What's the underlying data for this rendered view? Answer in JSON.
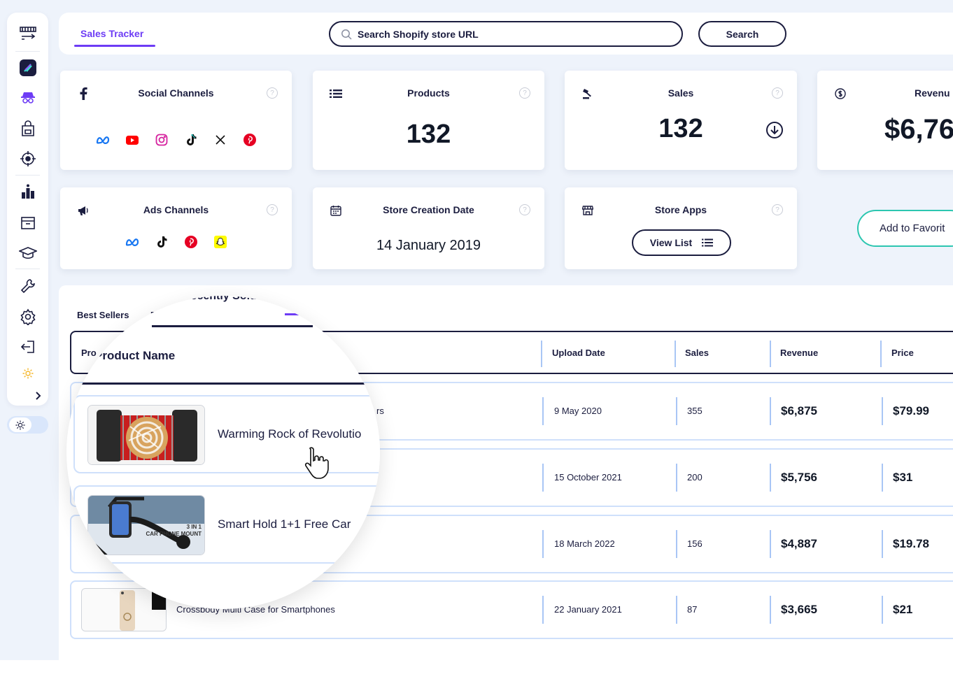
{
  "topbar": {
    "tab_label": "Sales Tracker",
    "search_placeholder": "Search Shopify store URL",
    "search_button": "Search"
  },
  "cards": {
    "social": {
      "title": "Social Channels",
      "icons": [
        "meta-icon",
        "youtube-icon",
        "instagram-icon",
        "tiktok-icon",
        "x-icon",
        "pinterest-icon"
      ]
    },
    "products": {
      "title": "Products",
      "value": "132"
    },
    "sales": {
      "title": "Sales",
      "value": "132"
    },
    "revenue": {
      "title": "Revenu",
      "value": "$6,76"
    },
    "ads": {
      "title": "Ads Channels",
      "icons": [
        "meta-icon",
        "tiktok-icon",
        "pinterest-icon",
        "snapchat-icon"
      ]
    },
    "creation": {
      "title": "Store Creation Date",
      "value": "14 January 2019"
    },
    "apps": {
      "title": "Store Apps",
      "button": "View List"
    },
    "favorite_button": "Add to Favorit"
  },
  "table": {
    "tabs": [
      "Best Sellers",
      "P"
    ],
    "headers": {
      "name": "Pro",
      "upload": "Upload Date",
      "sales": "Sales",
      "revenue": "Revenue",
      "price": "Price"
    },
    "rows": [
      {
        "name_tail": "rs",
        "upload": "9 May 2020",
        "sales": "355",
        "revenue": "$6,875",
        "price": "$79.99"
      },
      {
        "name_tail": "",
        "upload": "15 October 2021",
        "sales": "200",
        "revenue": "$5,756",
        "price": "$31"
      },
      {
        "name_tail": "",
        "upload": "18 March 2022",
        "sales": "156",
        "revenue": "$4,887",
        "price": "$19.78"
      },
      {
        "name_tail": "Crossbody Multi Case for Smartphones",
        "upload": "22 January 2021",
        "sales": "87",
        "revenue": "$3,665",
        "price": "$21"
      }
    ]
  },
  "magnifier": {
    "tab_label": "Recently Sold",
    "header": "Product Name",
    "rows": [
      {
        "name": "Warming Rock of Revolutio"
      },
      {
        "name": "Smart Hold 1+1 Free Car",
        "thumb_text_1": "3 IN 1",
        "thumb_text_2": "CAR PHONE MOUNT"
      }
    ]
  },
  "colors": {
    "accent": "#6d3cf5",
    "navy": "#1b1d3f",
    "teal": "#2cc6b0",
    "row_border": "#cfe0fb"
  }
}
